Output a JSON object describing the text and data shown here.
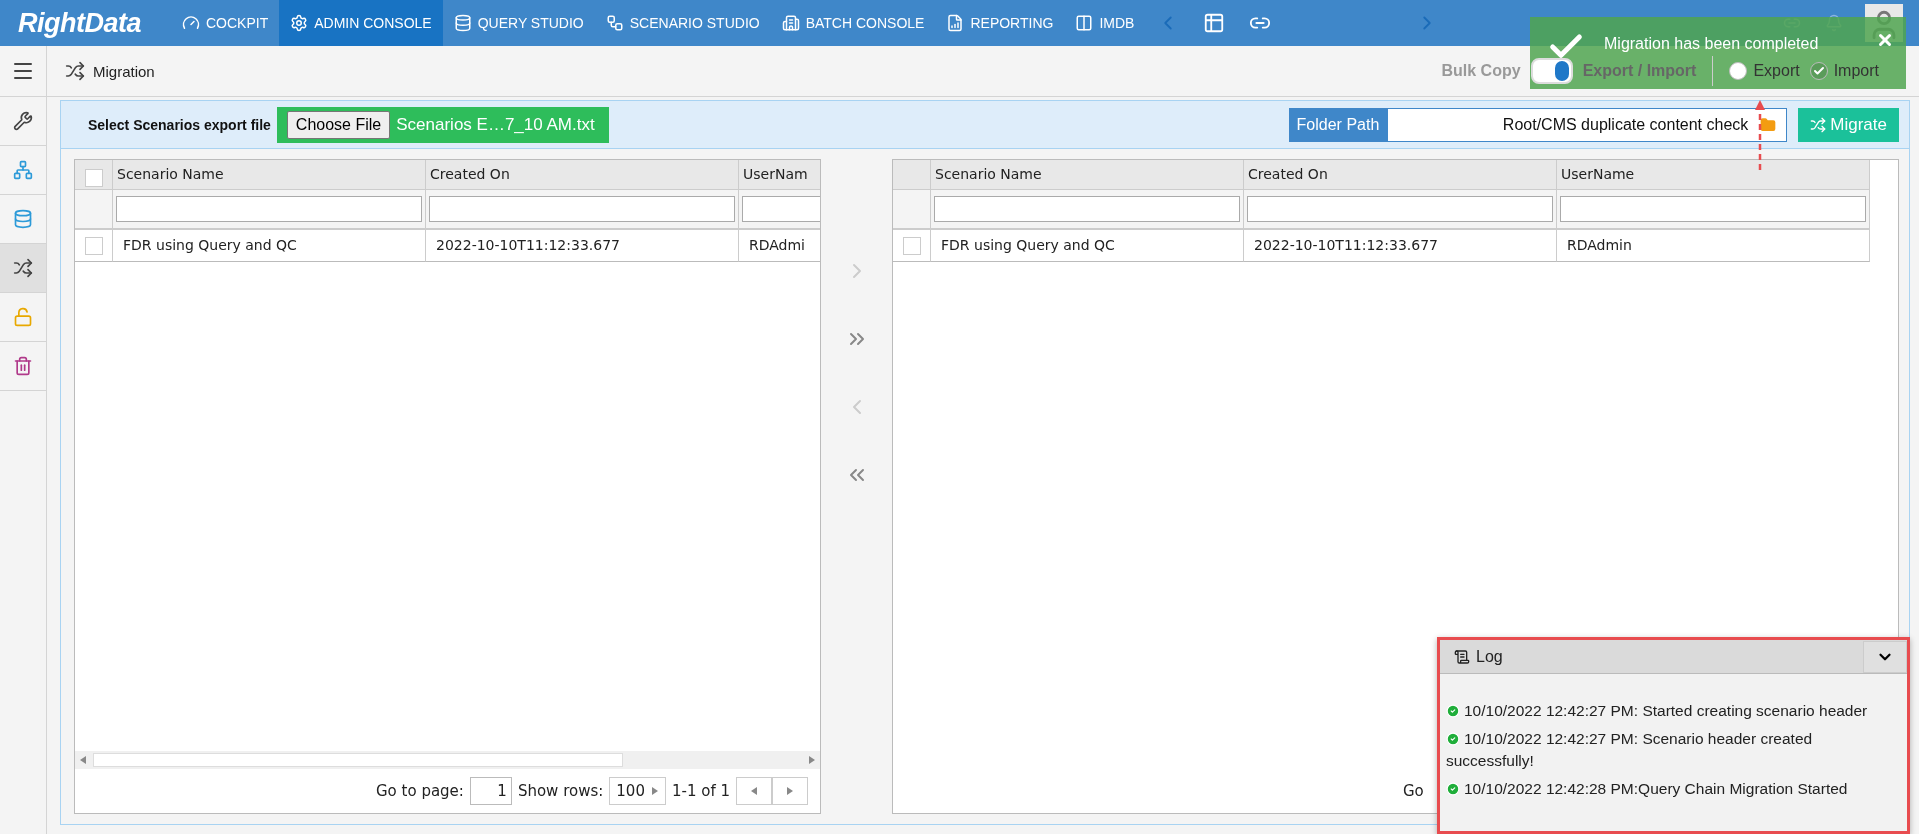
{
  "nav": {
    "logo": "RightData",
    "items": [
      {
        "kind": "cockpit",
        "label": "COCKPIT",
        "selected": false
      },
      {
        "kind": "gear",
        "label": "ADMIN CONSOLE",
        "selected": true
      },
      {
        "kind": "database",
        "label": "QUERY STUDIO",
        "selected": false
      },
      {
        "kind": "flow",
        "label": "SCENARIO STUDIO",
        "selected": false
      },
      {
        "kind": "batch",
        "label": "BATCH CONSOLE",
        "selected": false
      },
      {
        "kind": "report",
        "label": "REPORTING",
        "selected": false
      },
      {
        "kind": "columns",
        "label": "IMDB",
        "selected": false
      }
    ]
  },
  "page_title": "Migration",
  "mode": {
    "bulk_copy_label": "Bulk Copy",
    "toggle_on": true,
    "toggle_label": "Export / Import",
    "options": [
      {
        "label": "Export",
        "selected": false
      },
      {
        "label": "Import",
        "selected": true
      }
    ]
  },
  "sidebar": {
    "items": [
      {
        "kind": "tools",
        "selected": false
      },
      {
        "kind": "hierarchy",
        "selected": false
      },
      {
        "kind": "database",
        "selected": false
      },
      {
        "kind": "shuffle",
        "selected": true
      },
      {
        "kind": "lock",
        "selected": false
      },
      {
        "kind": "trash",
        "selected": false
      }
    ]
  },
  "file_picker": {
    "label": "Select Scenarios export file",
    "button": "Choose File",
    "file_name": "Scenarios E…7_10 AM.txt"
  },
  "folder": {
    "label": "Folder Path",
    "value": "Root/CMS duplicate content check"
  },
  "migrate_button": "Migrate",
  "source_grid": {
    "select_all_checked": false,
    "columns": [
      "Scenario Name",
      "Created On",
      "UserNam"
    ],
    "rows": [
      {
        "checked": false,
        "cells": [
          "FDR using Query and QC",
          "2022-10-10T11:12:33.677",
          "RDAdmi"
        ]
      }
    ],
    "pager": {
      "go_label": "Go to page:",
      "page": "1",
      "rows_label": "Show rows:",
      "rows": "100",
      "range": "1-1 of 1"
    }
  },
  "target_grid": {
    "columns": [
      "Scenario Name",
      "Created On",
      "UserName"
    ],
    "rows": [
      {
        "checked": false,
        "cells": [
          "FDR using Query and QC",
          "2022-10-10T11:12:33.677",
          "RDAdmin"
        ]
      }
    ],
    "pager": {
      "go_label": "Go"
    }
  },
  "log": {
    "title": "Log",
    "entries": [
      "10/10/2022 12:42:27 PM: Started creating scenario header",
      "10/10/2022 12:42:27 PM: Scenario header created successfully!",
      "10/10/2022 12:42:28 PM:Query Chain Migration Started"
    ]
  },
  "toast": {
    "message": "Migration has been completed"
  }
}
